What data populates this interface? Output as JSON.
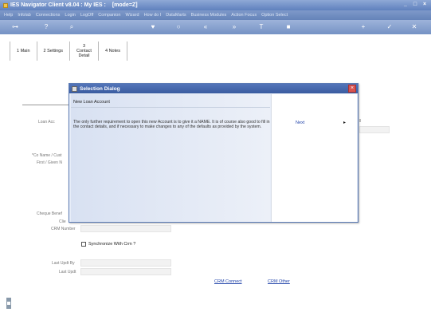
{
  "window": {
    "title": "IES Navigator Client v8.04 : My IES :",
    "mode": "[mode=Z]"
  },
  "menu": [
    "Help",
    "Infolab",
    "Connections",
    "Login",
    "LogOff",
    "Companion",
    "Wizard",
    "How do I",
    "DataMarts",
    "Business Modules",
    "Action Focus",
    "Option Select"
  ],
  "tabs": [
    {
      "label": "1 Main"
    },
    {
      "label": "2 Settings"
    },
    {
      "label": "3 Contact Detail"
    },
    {
      "label": "4 Notes"
    }
  ],
  "form": {
    "labels": {
      "loan_account": "Loan Acc",
      "co_name": "*Co Name / Cust",
      "first_given": "First / Given N",
      "cheque_benef": "Cheque Benef",
      "client": "Clie",
      "crm_number": "CRM Number",
      "last_updt_by": "Last Updt By",
      "last_updt": "Last Updt"
    },
    "sync_label": "Synchronize With Crm ?",
    "crm_connect": "CRM Connect",
    "crm_other": "CRM Other",
    "right_label": "ll"
  },
  "dialog": {
    "title": "Selection Dialog",
    "heading": "New Loan Account",
    "body": "The only further requirement to open this new Account is to give it a NAME. It is of course also good to fill in the contact details, and if necessary to make changes to any of the defaults as provided by the system.",
    "next_label": "Next",
    "next_arrow": "▸"
  }
}
